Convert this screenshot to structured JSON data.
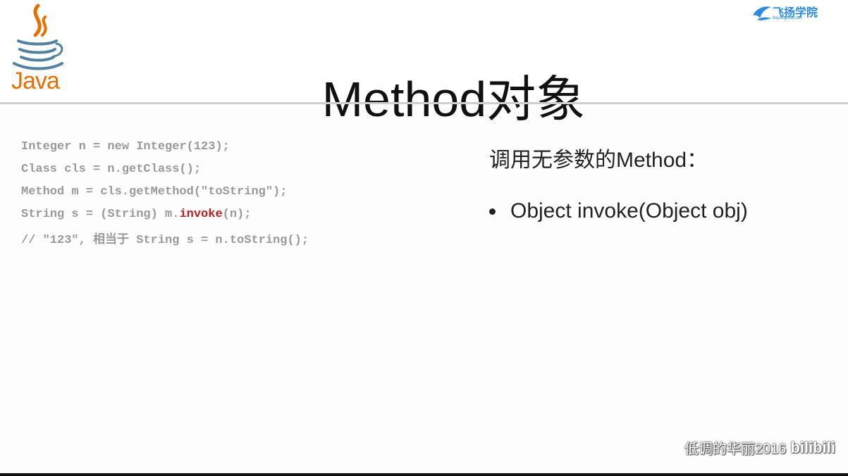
{
  "header": {
    "logo_text": "Java",
    "title": "Method对象",
    "brand": {
      "name": "飞扬学院",
      "url": "feiyangedu.com"
    }
  },
  "code": {
    "lines": [
      "Integer n = new Integer(123);",
      "Class cls = n.getClass();",
      "Method m = cls.getMethod(\"toString\");"
    ],
    "invoke_line": {
      "before": "String s = (String) m.",
      "highlight": "invoke",
      "after": "(n);"
    },
    "comment": "// \"123\", 相当于 String s = n.toString();"
  },
  "right": {
    "heading": "调用无参数的Method：",
    "bullets": [
      "Object invoke(Object obj)"
    ]
  },
  "watermark": {
    "text": "低调的华丽2016",
    "logo": "bilibili"
  },
  "colors": {
    "java_orange": "#e76f00",
    "java_blue": "#5382a1",
    "code_gray": "#9a9a9a",
    "highlight_red": "#b22222",
    "brand_blue": "#2a8be0"
  }
}
